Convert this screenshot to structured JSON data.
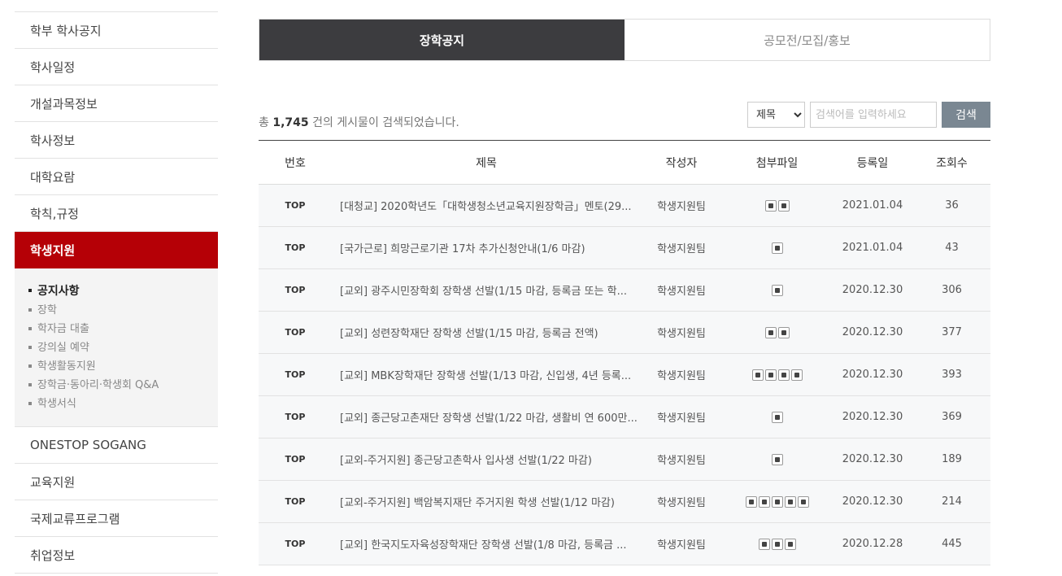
{
  "sidebar": {
    "items": [
      {
        "label": "학부 학사공지"
      },
      {
        "label": "학사일정"
      },
      {
        "label": "개설과목정보"
      },
      {
        "label": "학사정보"
      },
      {
        "label": "대학요람"
      },
      {
        "label": "학칙,규정"
      },
      {
        "label": "학생지원",
        "active": true
      }
    ],
    "sub_items": [
      {
        "label": "공지사항",
        "current": true
      },
      {
        "label": "장학"
      },
      {
        "label": "학자금 대출"
      },
      {
        "label": "강의실 예약"
      },
      {
        "label": "학생활동지원"
      },
      {
        "label": "장학금·동아리·학생회 Q&A"
      },
      {
        "label": "학생서식"
      }
    ],
    "items_after": [
      {
        "label": "ONESTOP SOGANG"
      },
      {
        "label": "교육지원"
      },
      {
        "label": "국제교류프로그램"
      },
      {
        "label": "취업정보"
      }
    ]
  },
  "tabs": [
    {
      "label": "장학공지",
      "active": true
    },
    {
      "label": "공모전/모집/홍보",
      "active": false
    }
  ],
  "summary": {
    "prefix": "총 ",
    "count": "1,745",
    "suffix": " 건의 게시물이 검색되었습니다."
  },
  "search": {
    "selected_option": "제목",
    "placeholder": "검색어를 입력하세요",
    "button_label": "검색"
  },
  "table": {
    "headers": [
      "번호",
      "제목",
      "작성자",
      "첨부파일",
      "등록일",
      "조회수"
    ],
    "rows": [
      {
        "no": "TOP",
        "title": "[대청교] 2020학년도「대학생청소년교육지원장학금」멘토(29...",
        "author": "학생지원팀",
        "attachments": 2,
        "date": "2021.01.04",
        "views": "36"
      },
      {
        "no": "TOP",
        "title": "[국가근로] 희망근로기관 17차 추가신청안내(1/6 마감)",
        "author": "학생지원팀",
        "attachments": 1,
        "date": "2021.01.04",
        "views": "43"
      },
      {
        "no": "TOP",
        "title": "[교외] 광주시민장학회 장학생 선발(1/15 마감, 등록금 또는 학...",
        "author": "학생지원팀",
        "attachments": 1,
        "date": "2020.12.30",
        "views": "306"
      },
      {
        "no": "TOP",
        "title": "[교외] 성련장학재단 장학생 선발(1/15 마감, 등록금 전액)",
        "author": "학생지원팀",
        "attachments": 2,
        "date": "2020.12.30",
        "views": "377"
      },
      {
        "no": "TOP",
        "title": "[교외] MBK장학재단 장학생 선발(1/13 마감, 신입생, 4년 등록...",
        "author": "학생지원팀",
        "attachments": 4,
        "date": "2020.12.30",
        "views": "393"
      },
      {
        "no": "TOP",
        "title": "[교외] 종근당고촌재단 장학생 선발(1/22 마감, 생활비 연 600만...",
        "author": "학생지원팀",
        "attachments": 1,
        "date": "2020.12.30",
        "views": "369"
      },
      {
        "no": "TOP",
        "title": "[교외-주거지원] 종근당고촌학사 입사생 선발(1/22 마감)",
        "author": "학생지원팀",
        "attachments": 1,
        "date": "2020.12.30",
        "views": "189"
      },
      {
        "no": "TOP",
        "title": "[교외-주거지원] 백암복지재단 주거지원 학생 선발(1/12 마감)",
        "author": "학생지원팀",
        "attachments": 5,
        "date": "2020.12.30",
        "views": "214"
      },
      {
        "no": "TOP",
        "title": "[교외] 한국지도자육성장학재단 장학생 선발(1/8 마감, 등록금 ...",
        "author": "학생지원팀",
        "attachments": 3,
        "date": "2020.12.28",
        "views": "445"
      }
    ]
  }
}
